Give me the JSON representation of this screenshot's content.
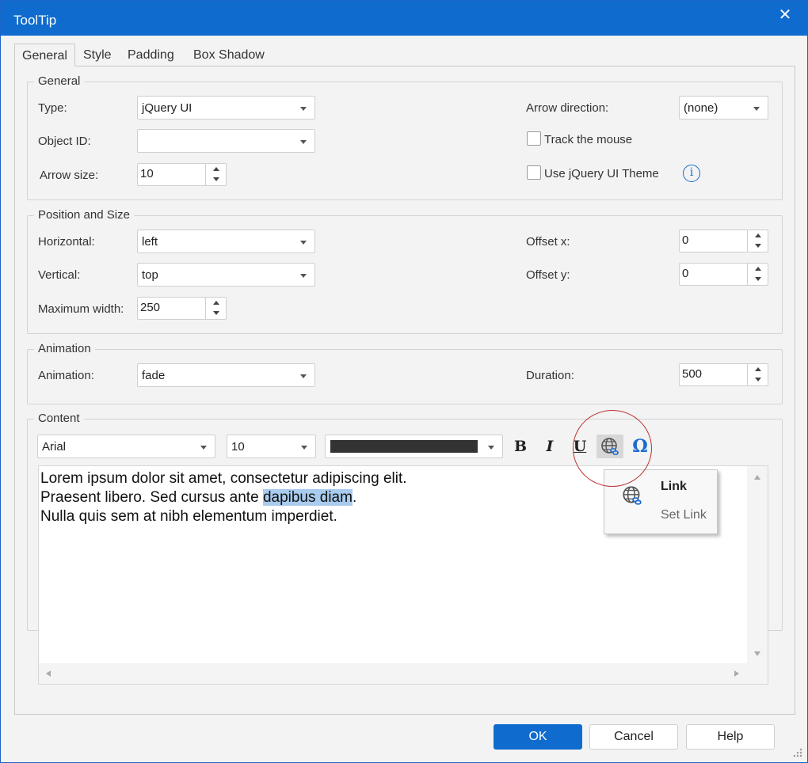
{
  "window": {
    "title": "ToolTip"
  },
  "tabs": [
    {
      "label": "General",
      "active": true
    },
    {
      "label": "Style",
      "active": false
    },
    {
      "label": "Padding",
      "active": false
    },
    {
      "label": "Box Shadow",
      "active": false
    }
  ],
  "general": {
    "title": "General",
    "type_label": "Type:",
    "type_value": "jQuery UI",
    "object_id_label": "Object ID:",
    "object_id_value": "",
    "arrow_size_label": "Arrow size:",
    "arrow_size_value": "10",
    "arrow_direction_label": "Arrow direction:",
    "arrow_direction_value": "(none)",
    "track_mouse_label": "Track the mouse",
    "track_mouse_checked": false,
    "use_theme_label": "Use jQuery UI Theme",
    "use_theme_checked": false,
    "info_glyph": "i"
  },
  "position": {
    "title": "Position and Size",
    "horizontal_label": "Horizontal:",
    "horizontal_value": "left",
    "vertical_label": "Vertical:",
    "vertical_value": "top",
    "max_width_label": "Maximum width:",
    "max_width_value": "250",
    "offset_x_label": "Offset x:",
    "offset_x_value": "0",
    "offset_y_label": "Offset y:",
    "offset_y_value": "0"
  },
  "animation": {
    "title": "Animation",
    "animation_label": "Animation:",
    "animation_value": "fade",
    "duration_label": "Duration:",
    "duration_value": "500"
  },
  "content": {
    "title": "Content",
    "font_value": "Arial",
    "size_value": "10",
    "text_color": "#333333",
    "toolbar": {
      "bold": "B",
      "italic": "I",
      "underline": "U",
      "special_char": "Ω"
    },
    "editor_lines": [
      {
        "text": "Lorem ipsum dolor sit amet, consectetur adipiscing elit."
      },
      {
        "before": "Praesent libero. Sed cursus ante ",
        "highlight": "dapibus diam",
        "after": "."
      },
      {
        "text": "Nulla quis sem at nibh elementum imperdiet."
      }
    ]
  },
  "link_popup": {
    "title": "Link",
    "action": "Set Link"
  },
  "buttons": {
    "ok": "OK",
    "cancel": "Cancel",
    "help": "Help"
  },
  "colors": {
    "accent": "#0f6cce",
    "highlight": "#a8cbee",
    "callout_circle": "#b33333"
  }
}
